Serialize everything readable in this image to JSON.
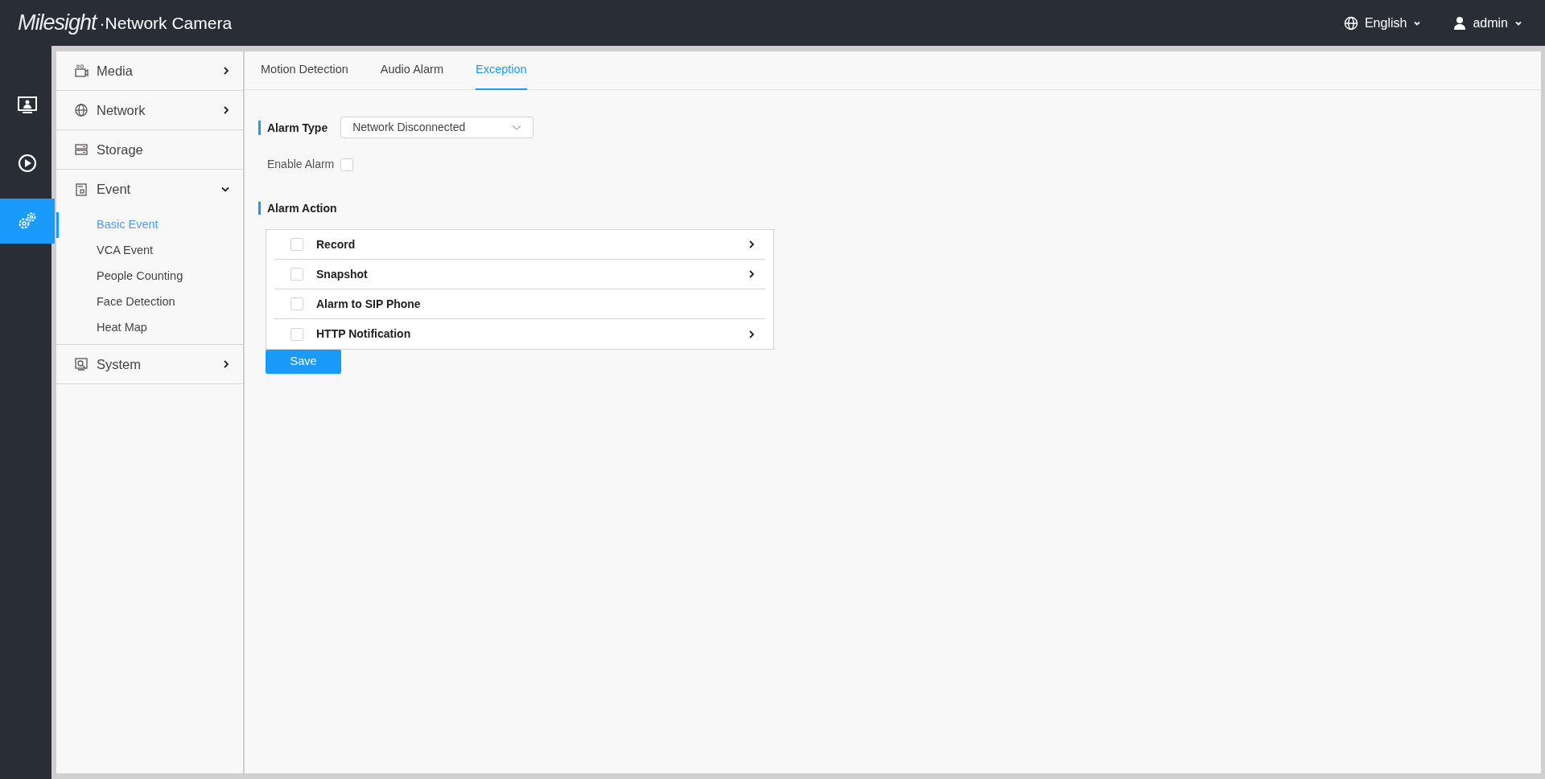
{
  "header": {
    "logo": "Milesight",
    "product": "·Network Camera",
    "language": "English",
    "user": "admin"
  },
  "rail": [
    {
      "kind": "live",
      "selected": false
    },
    {
      "kind": "playback",
      "selected": false
    },
    {
      "kind": "settings",
      "selected": true
    }
  ],
  "menu": [
    {
      "label": "Media",
      "kind": "media",
      "expanded": false
    },
    {
      "label": "Network",
      "kind": "network",
      "expanded": false
    },
    {
      "label": "Storage",
      "kind": "storage"
    },
    {
      "label": "Event",
      "kind": "event",
      "expanded": true,
      "children": [
        {
          "label": "Basic Event",
          "selected": true
        },
        {
          "label": "VCA Event",
          "selected": false
        },
        {
          "label": "People Counting",
          "selected": false
        },
        {
          "label": "Face Detection",
          "selected": false
        },
        {
          "label": "Heat Map",
          "selected": false
        }
      ]
    },
    {
      "label": "System",
      "kind": "system",
      "expanded": false
    }
  ],
  "tabs": [
    {
      "label": "Motion Detection",
      "selected": false
    },
    {
      "label": "Audio Alarm",
      "selected": false
    },
    {
      "label": "Exception",
      "selected": true
    }
  ],
  "alarm_type": {
    "label": "Alarm Type",
    "value": "Network Disconnected"
  },
  "enable_alarm": {
    "label": "Enable Alarm",
    "checked": false
  },
  "alarm_action": {
    "title": "Alarm Action",
    "items": [
      {
        "label": "Record",
        "checked": false,
        "has_detail": true
      },
      {
        "label": "Snapshot",
        "checked": false,
        "has_detail": true
      },
      {
        "label": "Alarm to SIP Phone",
        "checked": false,
        "has_detail": false
      },
      {
        "label": "HTTP Notification",
        "checked": false,
        "has_detail": true
      }
    ]
  },
  "save": "Save"
}
